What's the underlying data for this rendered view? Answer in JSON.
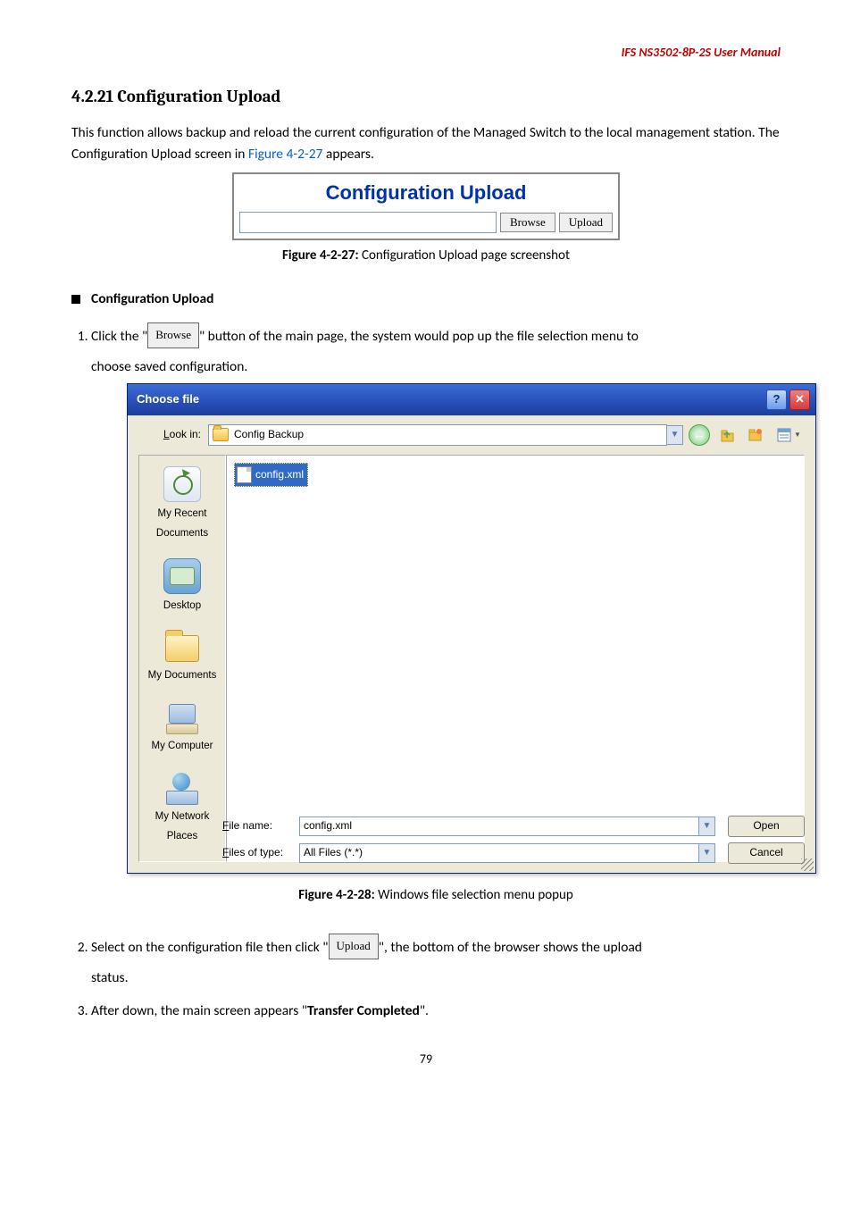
{
  "header": "IFS  NS3502-8P-2S  User Manual",
  "heading": "4.2.21 Configuration Upload",
  "intro_a": "This function allows backup and reload the current configuration of the Managed Switch to the local management station. The Configuration Upload screen in ",
  "intro_link": "Figure 4-2-27",
  "intro_b": " appears.",
  "widget_title": "Configuration Upload",
  "btn_browse": "Browse",
  "btn_upload": "Upload",
  "caption1_a": "Figure 4-2-27:",
  "caption1_b": " Configuration Upload page screenshot",
  "subheading": "Configuration Upload",
  "step1_a": "Click the \"",
  "step1_b": "\" button of the main page, the system would pop up the file selection menu to",
  "step1_c": "choose saved configuration.",
  "dialog": {
    "title": "Choose file",
    "lookin_label": "Look in:",
    "lookin_value": "Config Backup",
    "places": {
      "recent": "My Recent Documents",
      "desktop": "Desktop",
      "docs": "My Documents",
      "computer": "My Computer",
      "network": "My Network Places"
    },
    "file_selected": "config.xml",
    "filename_label": "File name:",
    "filename_value": "config.xml",
    "filetype_label": "Files of type:",
    "filetype_value": "All Files (*.*)",
    "open": "Open",
    "cancel": "Cancel"
  },
  "caption2_a": "Figure 4-2-28:",
  "caption2_b": " Windows file selection menu popup",
  "step2_a": "Select on the configuration file then click \"",
  "step2_b": "\", the bottom of the browser shows the upload",
  "step2_c": "status.",
  "step3_a": "After down, the main screen appears \"",
  "step3_bold": "Transfer Completed",
  "step3_b": "\".",
  "pagenum": "79"
}
